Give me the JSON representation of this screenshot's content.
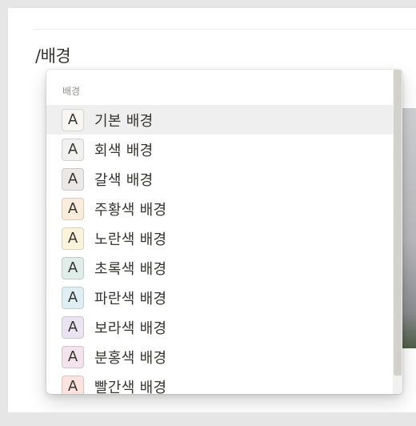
{
  "editor": {
    "command_text": "/배경"
  },
  "menu": {
    "header": "배경",
    "items": [
      {
        "glyph": "A",
        "label": "기본 배경",
        "bg": "#f7f6f3",
        "active": true
      },
      {
        "glyph": "A",
        "label": "회색 배경",
        "bg": "#f1f1ef"
      },
      {
        "glyph": "A",
        "label": "갈색 배경",
        "bg": "#ece8e6"
      },
      {
        "glyph": "A",
        "label": "주황색 배경",
        "bg": "#fbecdd"
      },
      {
        "glyph": "A",
        "label": "노란색 배경",
        "bg": "#fbf3db"
      },
      {
        "glyph": "A",
        "label": "초록색 배경",
        "bg": "#e0ede8"
      },
      {
        "glyph": "A",
        "label": "파란색 배경",
        "bg": "#dfedf5"
      },
      {
        "glyph": "A",
        "label": "보라색 배경",
        "bg": "#eae4f2"
      },
      {
        "glyph": "A",
        "label": "분홍색 배경",
        "bg": "#f4e2ec"
      },
      {
        "glyph": "A",
        "label": "빨간색 배경",
        "bg": "#fde3e0"
      }
    ]
  },
  "colors": {
    "text": "#37352f",
    "hover": "#efefef",
    "scroll_thumb": "#d3d1cb"
  }
}
